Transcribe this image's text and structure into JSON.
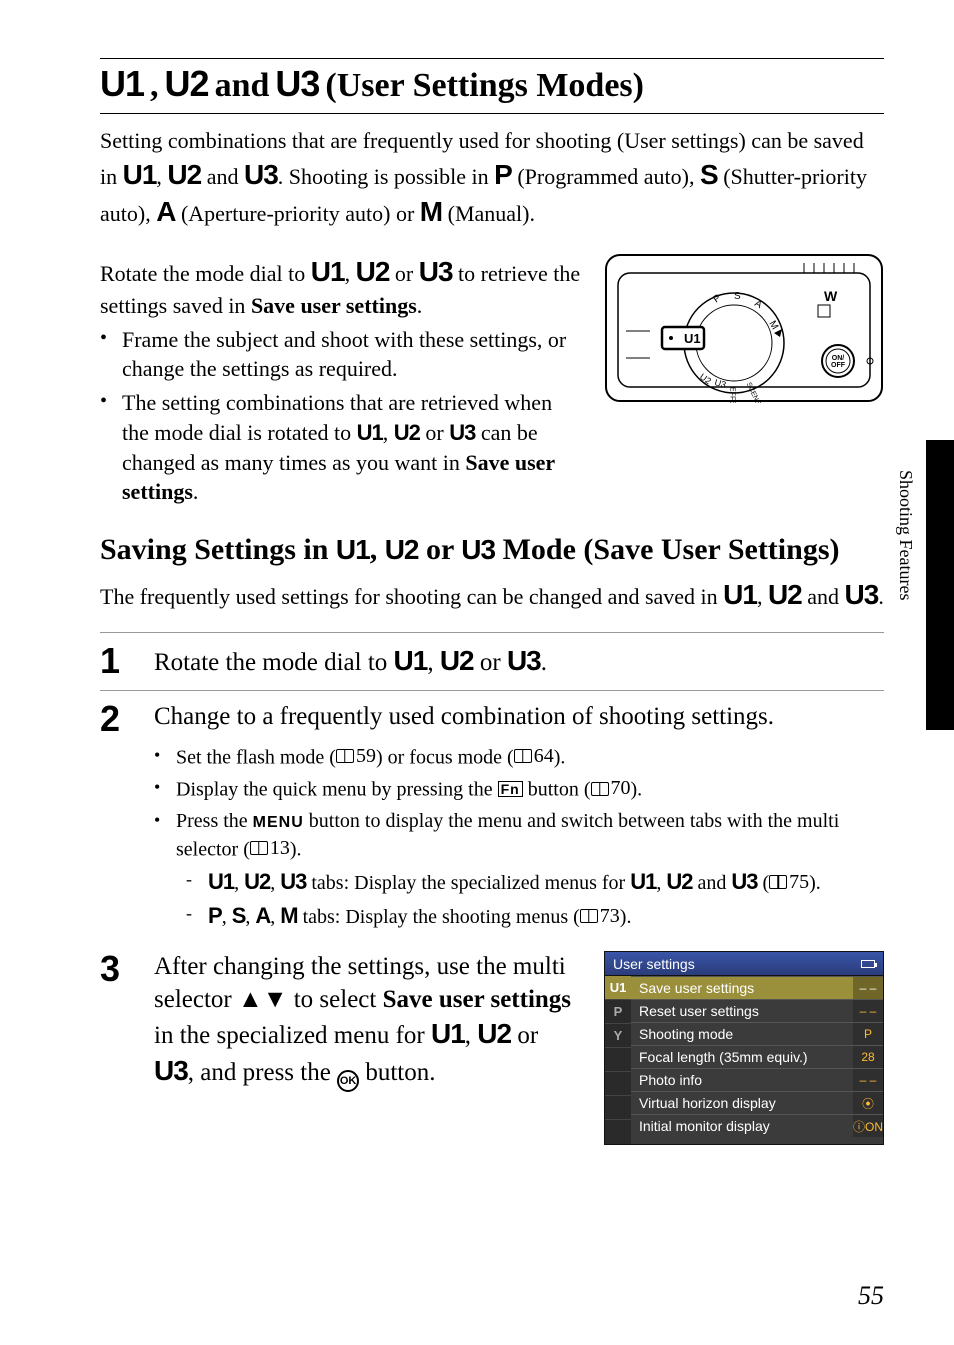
{
  "title": {
    "u1": "U1",
    "sep1": ", ",
    "u2": "U2",
    "and": " and ",
    "u3": "U3",
    "rest": " (User Settings Modes)"
  },
  "intro": {
    "t1": "Setting combinations that are frequently used for shooting (User settings) can be saved in ",
    "u1": "U1",
    "c1": ", ",
    "u2": "U2",
    "and": " and ",
    "u3": "U3",
    "t2": ". Shooting is possible in ",
    "P": "P",
    "ptxt": " (Programmed auto), ",
    "S": "S",
    "stxt": " (Shutter-priority auto), ",
    "A": "A",
    "atxt": " (Aperture-priority auto) or ",
    "M": "M",
    "mtxt": " (Manual)."
  },
  "block1": {
    "t1": "Rotate the mode dial to ",
    "u1": "U1",
    "c1": ", ",
    "u2": "U2",
    "or": " or ",
    "u3": "U3",
    "t2": " to retrieve the settings saved in ",
    "bold": "Save user settings",
    "dot": ".",
    "bul1": "Frame the subject and shoot with these settings, or change the settings as required.",
    "bul2a": "The setting combinations that are retrieved when the mode dial is rotated to ",
    "bul2_u1": "U1",
    "bul2_c": ", ",
    "bul2_u2": "U2",
    "bul2_or": " or ",
    "bul2_u3": "U3",
    "bul2b": " can be changed as many times as you want in ",
    "bul2_bold": "Save user settings",
    "bul2_dot": "."
  },
  "h2": {
    "t1": "Saving Settings in ",
    "u1": "U1",
    "c1": ", ",
    "u2": "U2",
    "or": " or ",
    "u3": "U3",
    "t2": " Mode (Save User Settings)"
  },
  "h2sub": {
    "t1": "The frequently used settings for shooting can be changed and saved in ",
    "u1": "U1",
    "c1": ", ",
    "u2": "U2",
    "and": " and ",
    "u3": "U3",
    "dot": "."
  },
  "steps": {
    "s1": {
      "num": "1",
      "title_a": "Rotate the mode dial to ",
      "u1": "U1",
      "c": ", ",
      "u2": "U2",
      "or": " or ",
      "u3": "U3",
      "dot": "."
    },
    "s2": {
      "num": "2",
      "title": "Change to a frequently used combination of shooting settings.",
      "b1a": "Set the flash mode (",
      "b1p": "59",
      "b1b": ") or focus mode (",
      "b1p2": "64",
      "b1c": ").",
      "b2a": "Display the quick menu by pressing the ",
      "b2btn": "Fn",
      "b2b": " button (",
      "b2p": "70",
      "b2c": ").",
      "b3a": "Press the ",
      "b3menu": "MENU",
      "b3b": " button to display the menu and switch between tabs with the multi selector (",
      "b3p": "13",
      "b3c": ").",
      "d1a": "",
      "d1_u1": "U1",
      "d1_c1": ", ",
      "d1_u2": "U2",
      "d1_c2": ", ",
      "d1_u3": "U3",
      "d1b": " tabs: Display the specialized menus for ",
      "d1_u1b": "U1",
      "d1_c3": ", ",
      "d1_u2b": "U2",
      "d1_and": " and ",
      "d1_u3b": "U3",
      "d1c": " (",
      "d1p": "75",
      "d1d": ").",
      "d2a": "",
      "d2_P": "P",
      "d2_c1": ", ",
      "d2_S": "S",
      "d2_c2": ", ",
      "d2_A": "A",
      "d2_c3": ", ",
      "d2_M": "M",
      "d2b": " tabs: Display the shooting menus (",
      "d2p": "73",
      "d2c": ")."
    },
    "s3": {
      "num": "3",
      "t1": "After changing the settings, use the multi selector ",
      "arrows": "▲▼",
      "t2": " to select ",
      "bold": "Save user settings",
      "t3": " in the specialized menu for ",
      "u1": "U1",
      "c": ", ",
      "u2": "U2",
      "or": " or ",
      "u3": "U3",
      "t4": ", and press the ",
      "ok": "OK",
      "t5": " button."
    }
  },
  "menu": {
    "title": "User settings",
    "tabs": [
      "U1",
      "P",
      "Y"
    ],
    "rows": [
      {
        "label": "Save user settings",
        "value": "– –",
        "sel": true
      },
      {
        "label": "Reset user settings",
        "value": "– –"
      },
      {
        "label": "Shooting mode",
        "value": "P"
      },
      {
        "label": "Focal length (35mm equiv.)",
        "value": "28"
      },
      {
        "label": "Photo info",
        "value": "– –"
      },
      {
        "label": "Virtual horizon display",
        "value": "⦿"
      },
      {
        "label": "Initial monitor display",
        "value": "ⓘON"
      }
    ]
  },
  "dial": {
    "labels": [
      "P",
      "S",
      "A",
      "M",
      "U1",
      "U2",
      "U3",
      "EFFECTS",
      "SCENE"
    ],
    "zoom_w": "W",
    "onoff": "ON/\nOFF"
  },
  "side": "Shooting Features",
  "page_num": "55"
}
